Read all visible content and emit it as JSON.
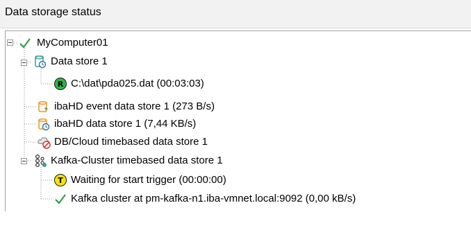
{
  "panel": {
    "title": "Data storage status"
  },
  "tree": {
    "root": {
      "label": "MyComputer01",
      "icon": "checkmark-icon",
      "expanded": true
    },
    "data_store_1": {
      "label": "Data store 1",
      "icon": "data-store-icon",
      "expanded": true,
      "child": {
        "label": "C:\\dat\\pda025.dat (00:03:03)",
        "icon": "recording-badge-icon",
        "badge_letter": "R"
      }
    },
    "event_store": {
      "label": "ibaHD event data store 1 (273 B/s)",
      "icon": "ibahd-event-store-icon"
    },
    "hd_store": {
      "label": "ibaHD data store 1 (7,44 KB/s)",
      "icon": "ibahd-data-store-icon"
    },
    "cloud_store": {
      "label": "DB/Cloud timebased data store 1",
      "icon": "db-cloud-error-icon"
    },
    "kafka_store": {
      "label": "Kafka-Cluster timebased data store 1",
      "icon": "kafka-cluster-icon",
      "expanded": true,
      "children": [
        {
          "label": "Waiting for start trigger (00:00:00)",
          "icon": "trigger-badge-icon",
          "badge_letter": "T"
        },
        {
          "label": "Kafka cluster at pm-kafka-n1.iba-vmnet.local:9092 (0,00 kB/s)",
          "icon": "checkmark-icon"
        }
      ]
    }
  },
  "colors": {
    "check_green": "#2e9d4c",
    "badge_green": "#2fb34a",
    "badge_yellow": "#ffe100",
    "store_orange": "#e69c2b",
    "store_teal": "#3a9c8c",
    "error_red": "#d9362b"
  }
}
